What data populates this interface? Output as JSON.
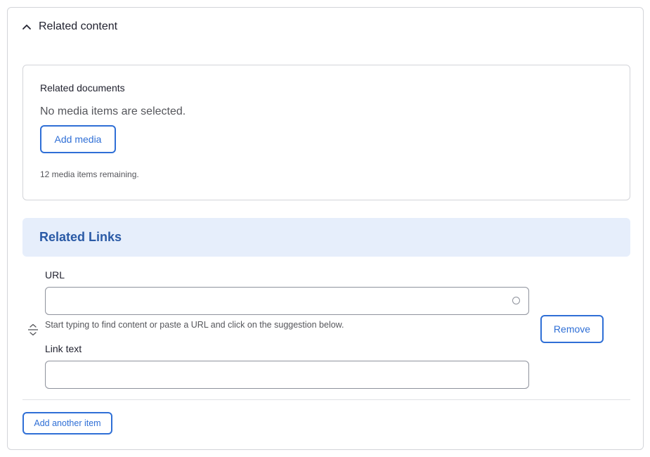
{
  "details": {
    "title": "Related content",
    "toggle_icon": "chevron-up-icon"
  },
  "documents": {
    "label": "Related documents",
    "empty_text": "No media items are selected.",
    "add_button": "Add media",
    "remaining_text": "12 media items remaining."
  },
  "links": {
    "heading": "Related Links",
    "item": {
      "url_label": "URL",
      "url_value": "",
      "url_help": "Start typing to find content or paste a URL and click on the suggestion below.",
      "link_text_label": "Link text",
      "link_text_value": "",
      "remove_button": "Remove",
      "drag_icon": "drag-handle-icon"
    },
    "add_another_button": "Add another item"
  },
  "colors": {
    "accent": "#2f6fd6",
    "header_bg": "#e6eefb",
    "header_text": "#2a5aa6",
    "border": "#d3d4d9"
  }
}
